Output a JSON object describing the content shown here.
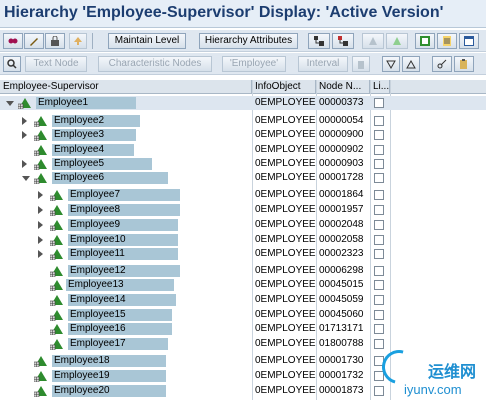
{
  "window": {
    "title": "Hierarchy 'Employee-Supervisor' Display: 'Active Version'"
  },
  "toolbar1": {
    "maintain_level": "Maintain Level",
    "hierarchy_attributes": "Hierarchy Attributes"
  },
  "toolbar2": {
    "text_node": "Text Node",
    "characteristic_nodes": "Characteristic Nodes",
    "employee": "'Employee'",
    "interval": "Interval"
  },
  "columns": {
    "col1": "Employee-Supervisor",
    "col2": "InfoObject",
    "col3": "Node N...",
    "col4": "Li..."
  },
  "rows": [
    {
      "label": "Employee1",
      "infoobject": "0EMPLOYEE",
      "node": "00000373"
    },
    {
      "label": "Employee2",
      "infoobject": "0EMPLOYEE",
      "node": "00000054"
    },
    {
      "label": "Employee3",
      "infoobject": "0EMPLOYEE",
      "node": "00000900"
    },
    {
      "label": "Employee4",
      "infoobject": "0EMPLOYEE",
      "node": "00000902"
    },
    {
      "label": "Employee5",
      "infoobject": "0EMPLOYEE",
      "node": "00000903"
    },
    {
      "label": "Employee6",
      "infoobject": "0EMPLOYEE",
      "node": "00001728"
    },
    {
      "label": "Employee7",
      "infoobject": "0EMPLOYEE",
      "node": "00001864"
    },
    {
      "label": "Employee8",
      "infoobject": "0EMPLOYEE",
      "node": "00001957"
    },
    {
      "label": "Employee9",
      "infoobject": "0EMPLOYEE",
      "node": "00002048"
    },
    {
      "label": "Employee10",
      "infoobject": "0EMPLOYEE",
      "node": "00002058"
    },
    {
      "label": "Employee11",
      "infoobject": "0EMPLOYEE",
      "node": "00002323"
    },
    {
      "label": "Employee12",
      "infoobject": "0EMPLOYEE",
      "node": "00006298"
    },
    {
      "label": "Employee13",
      "infoobject": "0EMPLOYEE",
      "node": "00045015"
    },
    {
      "label": "Employee14",
      "infoobject": "0EMPLOYEE",
      "node": "00045059"
    },
    {
      "label": "Employee15",
      "infoobject": "0EMPLOYEE",
      "node": "00045060"
    },
    {
      "label": "Employee16",
      "infoobject": "0EMPLOYEE",
      "node": "01713171"
    },
    {
      "label": "Employee17",
      "infoobject": "0EMPLOYEE",
      "node": "01800788"
    },
    {
      "label": "Employee18",
      "infoobject": "0EMPLOYEE",
      "node": "00001730"
    },
    {
      "label": "Employee19",
      "infoobject": "0EMPLOYEE",
      "node": "00001732"
    },
    {
      "label": "Employee20",
      "infoobject": "0EMPLOYEE",
      "node": "00001873"
    }
  ],
  "watermark": {
    "cn": "运维网",
    "en": "iyunv.com"
  },
  "colors": {
    "accent": "#1c3d70",
    "highlight": "#a9c6d6",
    "node_green": "#2e8b2e"
  }
}
